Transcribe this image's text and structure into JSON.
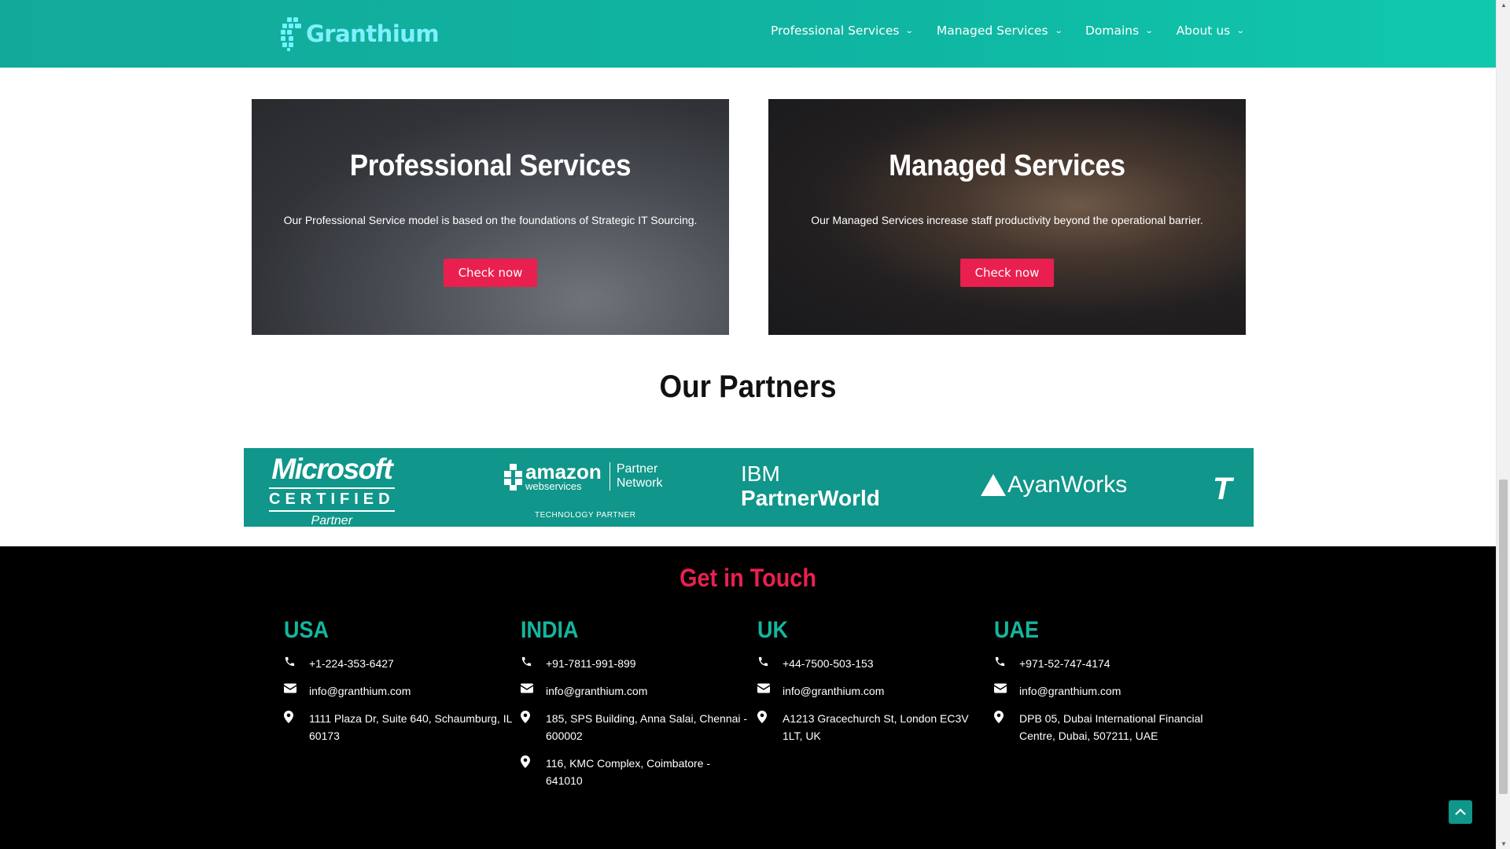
{
  "brand": {
    "name": "Granthium"
  },
  "nav": [
    {
      "label": "Professional Services"
    },
    {
      "label": "Managed Services"
    },
    {
      "label": "Domains"
    },
    {
      "label": "About us"
    }
  ],
  "cards": [
    {
      "title": "Professional Services",
      "text": "Our Professional Service model is based on the foundations of Strategic IT Sourcing.",
      "button": "Check now"
    },
    {
      "title": "Managed Services",
      "text": "Our Managed Services increase staff productivity beyond the operational barrier.",
      "button": "Check now"
    }
  ],
  "partners": {
    "title": "Our Partners",
    "microsoft": {
      "line1": "Microsoft",
      "line2": "CERTIFIED",
      "line3": "Partner"
    },
    "aws": {
      "line1": "amazon",
      "line2": "webservices",
      "line3a": "Partner",
      "line3b": "Network",
      "line4": "TECHNOLOGY PARTNER"
    },
    "ibm": {
      "line1": "IBM",
      "line2": "PartnerWorld"
    },
    "ayan": {
      "name": "AyanWorks"
    },
    "last": {
      "text": "T"
    }
  },
  "footer": {
    "title": "Get in Touch",
    "offices": [
      {
        "country": "USA",
        "phone": "+1-224-353-6427",
        "email": "info@granthium.com",
        "address1": "1111 Plaza Dr, Suite 640, Schaumburg, IL 60173"
      },
      {
        "country": "INDIA",
        "phone": "+91-7811-991-899",
        "email": "info@granthium.com",
        "address1": "185, SPS Building, Anna Salai, Chennai - 600002",
        "address2": "116, KMC Complex, Coimbatore - 641010"
      },
      {
        "country": "UK",
        "phone": "+44-7500-503-153",
        "email": "info@granthium.com",
        "address1": "A1213 Gracechurch St, London EC3V 1LT, UK"
      },
      {
        "country": "UAE",
        "phone": "+971-52-747-4174",
        "email": "info@granthium.com",
        "address1": "DPB 05, Dubai International Financial Centre, Dubai, 507211, UAE"
      }
    ]
  },
  "icons": {
    "phone": "phone-icon",
    "email": "envelope-icon",
    "location": "map-pin-icon",
    "chevron": "chevron-down-icon",
    "scroll_top": "chevron-up-icon"
  },
  "colors": {
    "header": "#10b9a4",
    "accent": "#e9204f",
    "teal_heading": "#16b59e",
    "partner_band": "#10968a",
    "footer_bg": "#000000"
  }
}
